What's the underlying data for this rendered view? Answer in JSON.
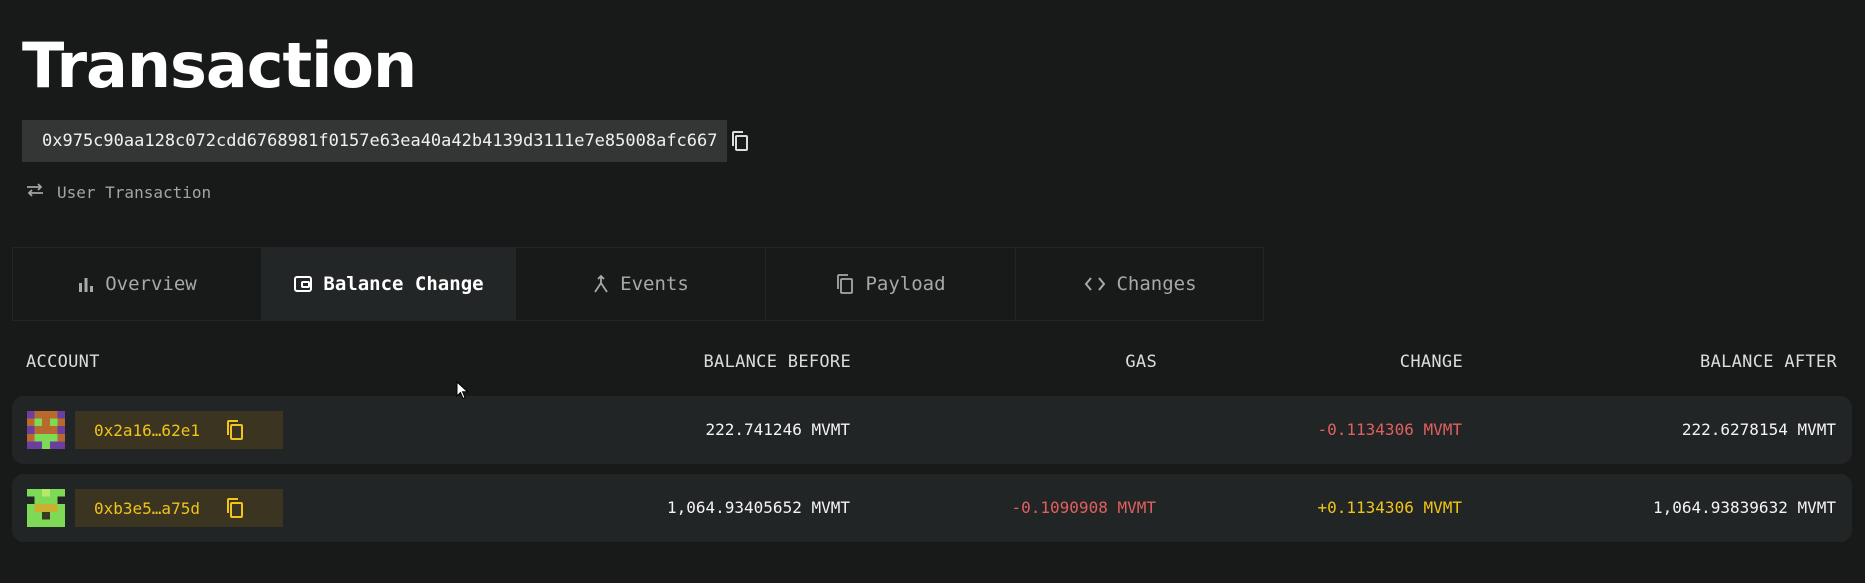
{
  "page": {
    "title": "Transaction",
    "hash": "0x975c90aa128c072cdd6768981f0157e63ea40a42b4139d3111e7e85008afc667",
    "tx_type": "User Transaction"
  },
  "tabs": [
    {
      "label": "Overview",
      "icon": "bar-chart-icon",
      "active": false
    },
    {
      "label": "Balance Change",
      "icon": "wallet-icon",
      "active": true
    },
    {
      "label": "Events",
      "icon": "merge-arrow-icon",
      "active": false
    },
    {
      "label": "Payload",
      "icon": "copy-pages-icon",
      "active": false
    },
    {
      "label": "Changes",
      "icon": "code-brackets-icon",
      "active": false
    }
  ],
  "table": {
    "headers": {
      "account": "ACCOUNT",
      "balance_before": "BALANCE BEFORE",
      "gas": "GAS",
      "change": "CHANGE",
      "balance_after": "BALANCE AFTER"
    },
    "rows": [
      {
        "address": "0x2a16…62e1",
        "balance_before": "222.741246 MVMT",
        "gas": "",
        "change": "-0.1134306 MVMT",
        "balance_after": "222.6278154 MVMT"
      },
      {
        "address": "0xb3e5…a75d",
        "balance_before": "1,064.93405652 MVMT",
        "gas": "-0.1090908 MVMT",
        "change": "+0.1134306 MVMT",
        "balance_after": "1,064.93839632 MVMT"
      }
    ]
  },
  "colors": {
    "background": "#181a1a",
    "accent_yellow": "#f0c419",
    "negative_red": "#e06060",
    "chip_bg": "#3a3420"
  }
}
